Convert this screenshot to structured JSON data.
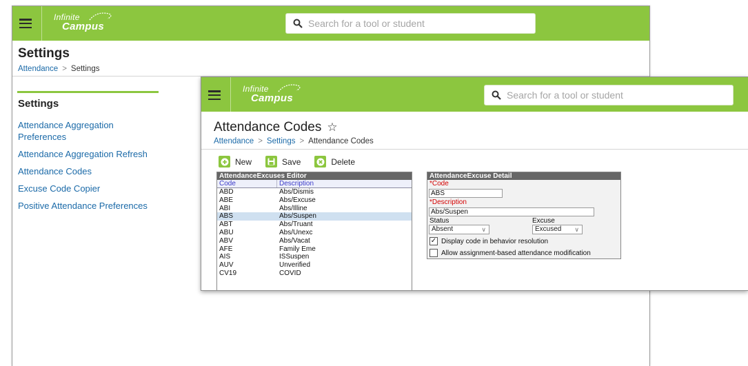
{
  "brand": {
    "line1": "Infinite",
    "line2": "Campus"
  },
  "search": {
    "placeholder": "Search for a tool or student"
  },
  "back_page": {
    "title": "Settings",
    "breadcrumb": [
      "Attendance",
      "Settings"
    ],
    "sidebar": {
      "title": "Settings",
      "items": [
        {
          "label": "Attendance Aggregation Preferences"
        },
        {
          "label": "Attendance Aggregation Refresh"
        },
        {
          "label": "Attendance Codes"
        },
        {
          "label": "Excuse Code Copier"
        },
        {
          "label": "Positive Attendance Preferences"
        }
      ]
    }
  },
  "front_page": {
    "title": "Attendance Codes",
    "breadcrumb": [
      "Attendance",
      "Settings",
      "Attendance Codes"
    ],
    "toolbar": {
      "new_label": "New",
      "save_label": "Save",
      "delete_label": "Delete"
    },
    "editor": {
      "title": "AttendanceExcuses Editor",
      "columns": [
        "Code",
        "Description"
      ],
      "rows": [
        {
          "code": "ABD",
          "description": "Abs/Dismis"
        },
        {
          "code": "ABE",
          "description": "Abs/Excuse"
        },
        {
          "code": "ABI",
          "description": "Abs/Illine"
        },
        {
          "code": "ABS",
          "description": "Abs/Suspen"
        },
        {
          "code": "ABT",
          "description": "Abs/Truant"
        },
        {
          "code": "ABU",
          "description": "Abs/Unexc"
        },
        {
          "code": "ABV",
          "description": "Abs/Vacat"
        },
        {
          "code": "AFE",
          "description": "Family Eme"
        },
        {
          "code": "AIS",
          "description": "ISSuspen"
        },
        {
          "code": "AUV",
          "description": "Unverified"
        },
        {
          "code": "CV19",
          "description": "COVID"
        }
      ],
      "selected_code": "ABS"
    },
    "detail": {
      "title": "AttendanceExcuse Detail",
      "code_label": "*Code",
      "code_value": "ABS",
      "description_label": "*Description",
      "description_value": "Abs/Suspen",
      "status_label": "Status",
      "status_value": "Absent",
      "excuse_label": "Excuse",
      "excuse_value": "Excused",
      "checkbox1_label": "Display code in behavior resolution",
      "checkbox1_checked": true,
      "checkbox2_label": "Allow assignment-based attendance modification",
      "checkbox2_checked": false
    }
  },
  "colors": {
    "brand_green": "#8cc63f",
    "link_blue": "#1b6aa8",
    "header_gray": "#666666"
  }
}
